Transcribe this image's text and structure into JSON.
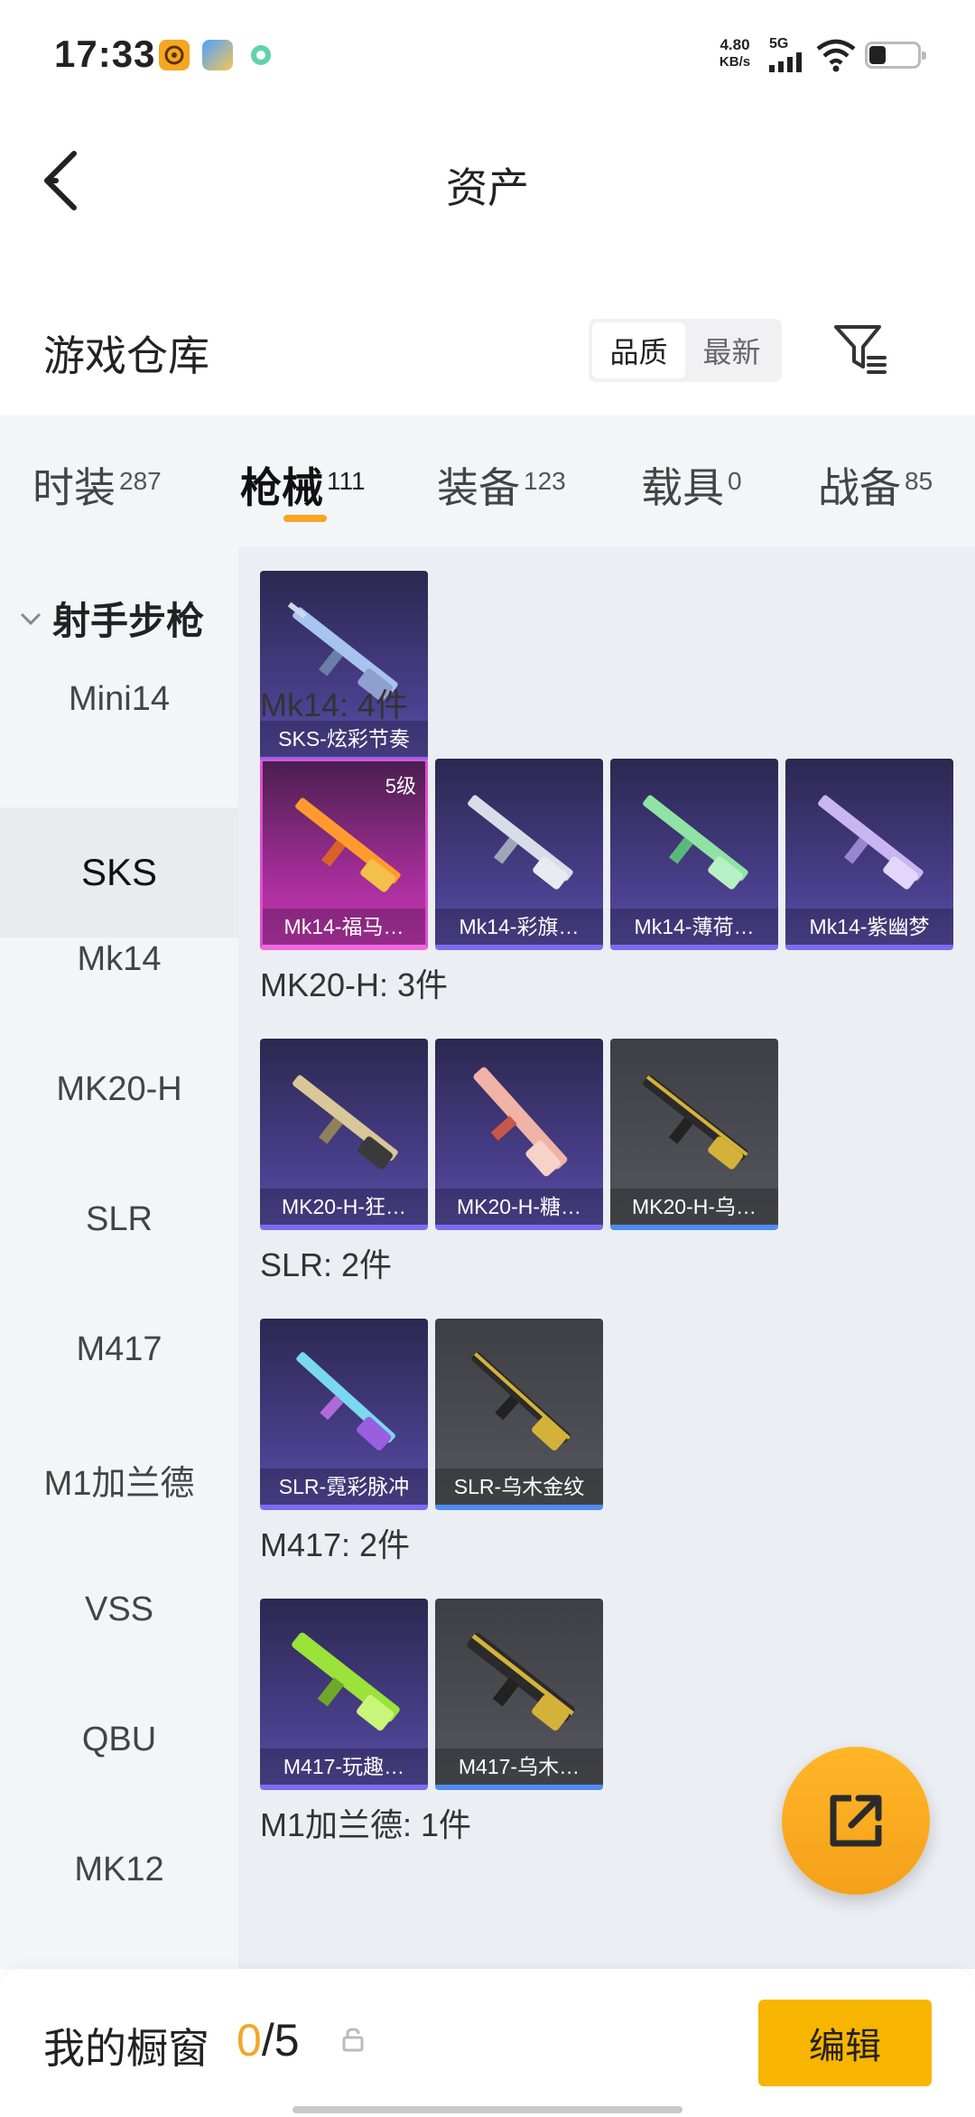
{
  "status_bar": {
    "time": "17:33",
    "net_speed": "4.80",
    "net_unit": "KB/s",
    "network_type": "5G"
  },
  "header": {
    "title": "资产"
  },
  "warehouse": {
    "title": "游戏仓库",
    "sort_options": [
      "品质",
      "最新"
    ],
    "sort_selected": "品质"
  },
  "tabs": [
    {
      "label": "时装",
      "count": "287"
    },
    {
      "label": "枪械",
      "count": "111"
    },
    {
      "label": "装备",
      "count": "123"
    },
    {
      "label": "载具",
      "count": "0"
    },
    {
      "label": "战备",
      "count": "85"
    }
  ],
  "active_tab": "枪械",
  "sidebar": {
    "group": "射手步枪",
    "items": [
      "Mini14",
      "SKS",
      "Mk14",
      "MK20-H",
      "SLR",
      "M417",
      "M1加兰德",
      "VSS",
      "QBU",
      "MK12"
    ],
    "active": "SKS"
  },
  "content": {
    "sks_card": {
      "name": "SKS-炫彩节奏",
      "rarity": "purple"
    },
    "groups": [
      {
        "label": "Mk14: 4件",
        "items": [
          {
            "name": "Mk14-福马…",
            "rarity": "pink",
            "level": "5级",
            "color": "#ff9a2f"
          },
          {
            "name": "Mk14-彩旗…",
            "rarity": "purple",
            "color": "#d8dde8"
          },
          {
            "name": "Mk14-薄荷…",
            "rarity": "purple",
            "color": "#8fe3a5"
          },
          {
            "name": "Mk14-紫幽梦",
            "rarity": "purple",
            "color": "#c9b6f0"
          }
        ]
      },
      {
        "label": "MK20-H: 3件",
        "items": [
          {
            "name": "MK20-H-狂…",
            "rarity": "purple",
            "color": "#d9c79a"
          },
          {
            "name": "MK20-H-糖…",
            "rarity": "purple",
            "color": "#f0b3a6"
          },
          {
            "name": "MK20-H-乌…",
            "rarity": "gray",
            "color": "#d4b23a"
          }
        ]
      },
      {
        "label": "SLR: 2件",
        "items": [
          {
            "name": "SLR-霓彩脉冲",
            "rarity": "purple",
            "color": "#7ad8ef"
          },
          {
            "name": "SLR-乌木金纹",
            "rarity": "gray",
            "color": "#d4b23a"
          }
        ]
      },
      {
        "label": "M417: 2件",
        "items": [
          {
            "name": "M417-玩趣…",
            "rarity": "purple",
            "color": "#9be23a"
          },
          {
            "name": "M417-乌木…",
            "rarity": "gray",
            "color": "#d4b23a"
          }
        ]
      },
      {
        "label": "M1加兰德: 1件",
        "items": []
      }
    ]
  },
  "bottom_bar": {
    "label": "我的橱窗",
    "current": "0",
    "separator": "/",
    "total": "5",
    "edit_label": "编辑"
  },
  "colors": {
    "accent": "#f5a623",
    "edit_button": "#f7b500",
    "purple_rarity": "#7b6cf0",
    "pink_rarity": "#e04ed0",
    "gray_rarity_bar": "#4f8cf0"
  }
}
